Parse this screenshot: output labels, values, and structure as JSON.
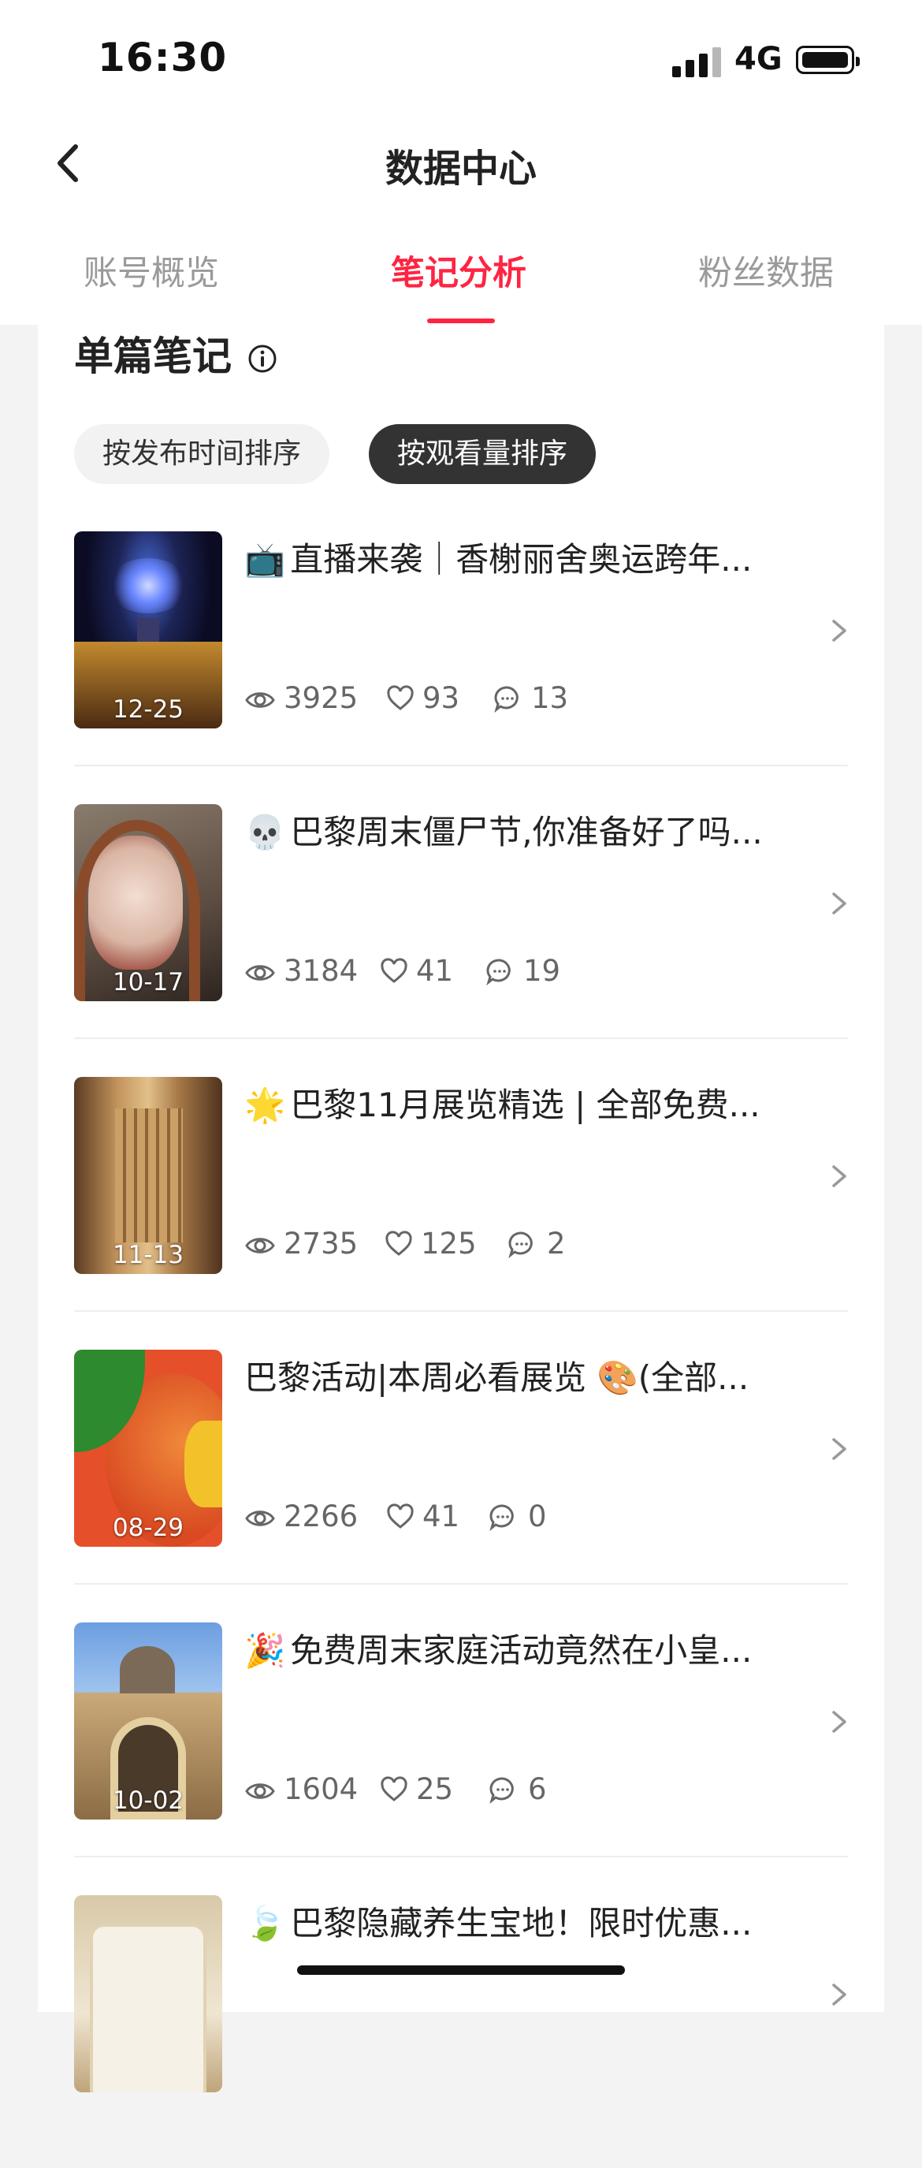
{
  "status_bar": {
    "time": "16:30",
    "network": "4G"
  },
  "nav": {
    "title": "数据中心"
  },
  "tabs": [
    {
      "label": "账号概览",
      "active": false
    },
    {
      "label": "笔记分析",
      "active": true
    },
    {
      "label": "粉丝数据",
      "active": false
    }
  ],
  "section": {
    "title": "单篇笔记"
  },
  "sort_chips": [
    {
      "label": "按发布时间排序",
      "selected": false
    },
    {
      "label": "按观看量排序",
      "selected": true
    }
  ],
  "notes": [
    {
      "emoji": "📺",
      "title": "直播来袭｜香榭丽舍奥运跨年...",
      "date": "12-25",
      "views": "3925",
      "likes": "93",
      "comments": "13"
    },
    {
      "emoji": "💀",
      "title": "巴黎周末僵尸节,你准备好了吗...",
      "date": "10-17",
      "views": "3184",
      "likes": "41",
      "comments": "19"
    },
    {
      "emoji": "🌟",
      "title": "巴黎11月展览精选 | 全部免费...",
      "date": "11-13",
      "views": "2735",
      "likes": "125",
      "comments": "2"
    },
    {
      "emoji": "",
      "title": "巴黎活动|本周必看展览 🎨(全部...",
      "date": "08-29",
      "views": "2266",
      "likes": "41",
      "comments": "0"
    },
    {
      "emoji": "🎉",
      "title": "免费周末家庭活动竟然在小皇...",
      "date": "10-02",
      "views": "1604",
      "likes": "25",
      "comments": "6"
    },
    {
      "emoji": "🍃",
      "title": "巴黎隐藏养生宝地！限时优惠...",
      "date": "",
      "views": "",
      "likes": "",
      "comments": ""
    }
  ],
  "colors": {
    "accent": "#ff2442",
    "chip_active_bg": "#333333",
    "page_bg": "#f3f3f3"
  }
}
